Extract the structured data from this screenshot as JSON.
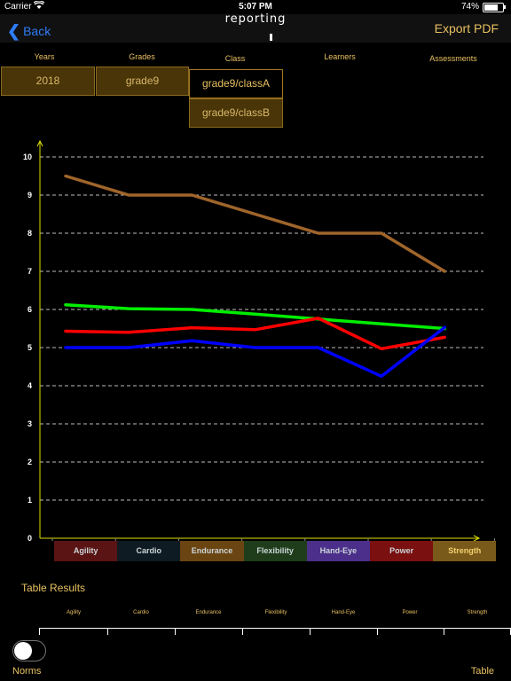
{
  "status_bar": {
    "carrier": "Carrier",
    "time": "5:07 PM",
    "battery": "74%",
    "battery_level": 0.74
  },
  "navbar": {
    "back_label": "Back",
    "logo_text": "reporting",
    "export_label": "Export PDF"
  },
  "filters": {
    "labels": [
      "Years",
      "Grades",
      "Class",
      "Learners",
      "Assessments"
    ],
    "year": "2018",
    "grade": "grade9",
    "classes": [
      "grade9/classA",
      "grade9/classB"
    ]
  },
  "chart_data": {
    "type": "line",
    "categories": [
      "Agility",
      "Cardio",
      "Endurance",
      "Flexibility",
      "Hand-Eye",
      "Power",
      "Strength"
    ],
    "ylim": [
      0,
      10
    ],
    "yticks": [
      "0",
      "1",
      "2",
      "3",
      "4",
      "5",
      "6",
      "7",
      "8",
      "9",
      "10"
    ],
    "grid": true,
    "series": [
      {
        "color": "#a0652a",
        "values": [
          9.5,
          9.0,
          9.0,
          8.5,
          8.0,
          8.0,
          7.0
        ]
      },
      {
        "color": "#00ee00",
        "values": [
          6.12,
          6.02,
          6.0,
          5.88,
          5.75,
          5.62,
          5.5
        ]
      },
      {
        "color": "#ff0000",
        "values": [
          5.43,
          5.4,
          5.52,
          5.47,
          5.77,
          4.97,
          5.27
        ]
      },
      {
        "color": "#0000ff",
        "values": [
          5.0,
          5.0,
          5.18,
          5.0,
          5.0,
          4.25,
          5.53
        ]
      }
    ],
    "legend": [
      {
        "label": "Agility",
        "bg": "#5a1414"
      },
      {
        "label": "Cardio",
        "bg": "#0f1b22"
      },
      {
        "label": "Endurance",
        "bg": "#6a4512"
      },
      {
        "label": "Flexibility",
        "bg": "#1f3d1a"
      },
      {
        "label": "Hand-Eye",
        "bg": "#4c2f8a"
      },
      {
        "label": "Power",
        "bg": "#7a1010"
      },
      {
        "label": "Strength",
        "bg": "#7a5a1a"
      }
    ]
  },
  "table": {
    "title": "Table Results",
    "columns": [
      "Agility",
      "Cardio",
      "Endurance",
      "Flexibility",
      "Hand-Eye",
      "Power",
      "Strength"
    ]
  },
  "footer": {
    "norms_label": "Norms",
    "norms_on": false,
    "table_label": "Table"
  },
  "colors": {
    "accent": "#e8c060",
    "link": "#2f7cf6",
    "axis": "#e0e000"
  }
}
